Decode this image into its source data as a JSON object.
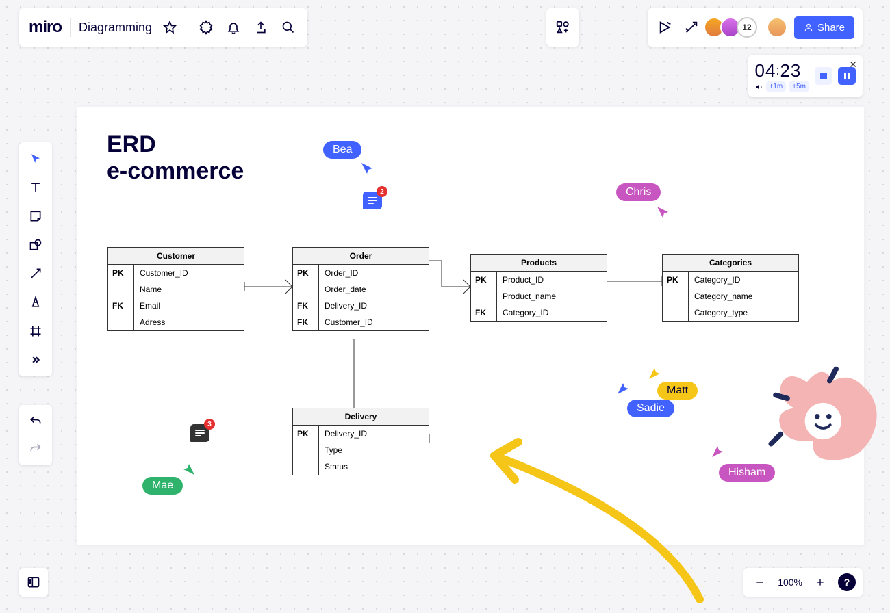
{
  "header": {
    "logo": "miro",
    "board_name": "Diagramming",
    "avatar_overflow": "12",
    "share_label": "Share"
  },
  "timer": {
    "minutes": "04",
    "seconds": "23",
    "add1m": "+1m",
    "add5m": "+5m"
  },
  "zoom": {
    "percent": "100%",
    "help": "?"
  },
  "frame": {
    "title_line1": "ERD",
    "title_line2": "e-commerce"
  },
  "tables": {
    "customer": {
      "name": "Customer",
      "rows": [
        {
          "key": "PK",
          "attr": "Customer_ID"
        },
        {
          "key": "",
          "attr": "Name"
        },
        {
          "key": "FK",
          "attr": "Email"
        },
        {
          "key": "",
          "attr": "Adress"
        }
      ]
    },
    "order": {
      "name": "Order",
      "rows": [
        {
          "key": "PK",
          "attr": "Order_ID"
        },
        {
          "key": "",
          "attr": "Order_date"
        },
        {
          "key": "FK",
          "attr": "Delivery_ID"
        },
        {
          "key": "FK",
          "attr": "Customer_ID"
        }
      ]
    },
    "products": {
      "name": "Products",
      "rows": [
        {
          "key": "PK",
          "attr": "Product_ID"
        },
        {
          "key": "",
          "attr": "Product_name"
        },
        {
          "key": "FK",
          "attr": "Category_ID"
        }
      ]
    },
    "categories": {
      "name": "Categories",
      "rows": [
        {
          "key": "PK",
          "attr": "Category_ID"
        },
        {
          "key": "",
          "attr": "Category_name"
        },
        {
          "key": "",
          "attr": "Category_type"
        }
      ]
    },
    "delivery": {
      "name": "Delivery",
      "rows": [
        {
          "key": "PK",
          "attr": "Delivery_ID"
        },
        {
          "key": "",
          "attr": "Type"
        },
        {
          "key": "",
          "attr": "Status"
        }
      ]
    }
  },
  "cursors": {
    "bea": {
      "label": "Bea",
      "color": "#4262ff"
    },
    "chris": {
      "label": "Chris",
      "color": "#c856c1"
    },
    "mae": {
      "label": "Mae",
      "color": "#2fb36c"
    },
    "sadie": {
      "label": "Sadie",
      "color": "#4262ff"
    },
    "matt": {
      "label": "Matt",
      "color": "#f5c518",
      "text": "#050038"
    },
    "hisham": {
      "label": "Hisham",
      "color": "#c856c1"
    }
  },
  "comments": {
    "c1": {
      "count": "2"
    },
    "c2": {
      "count": "3"
    }
  }
}
